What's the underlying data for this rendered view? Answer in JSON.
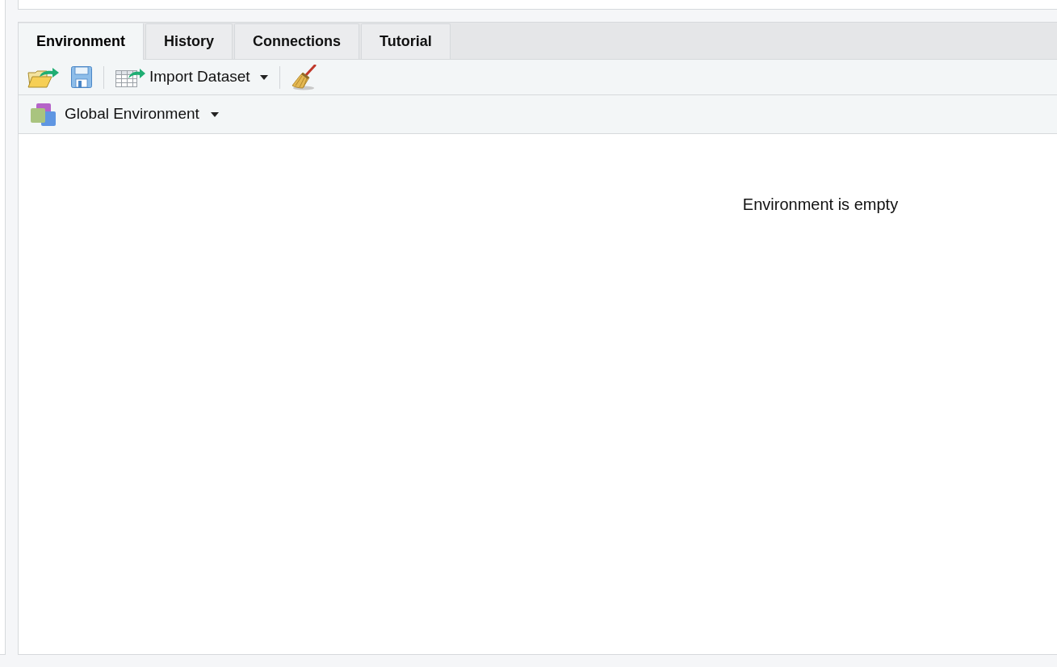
{
  "tabs": [
    {
      "label": "Environment",
      "selected": true
    },
    {
      "label": "History",
      "selected": false
    },
    {
      "label": "Connections",
      "selected": false
    },
    {
      "label": "Tutorial",
      "selected": false
    }
  ],
  "toolbar": {
    "import_button": {
      "label": "Import Dataset"
    }
  },
  "environment_selector": {
    "label": "Global Environment"
  },
  "empty_message": "Environment is empty"
}
